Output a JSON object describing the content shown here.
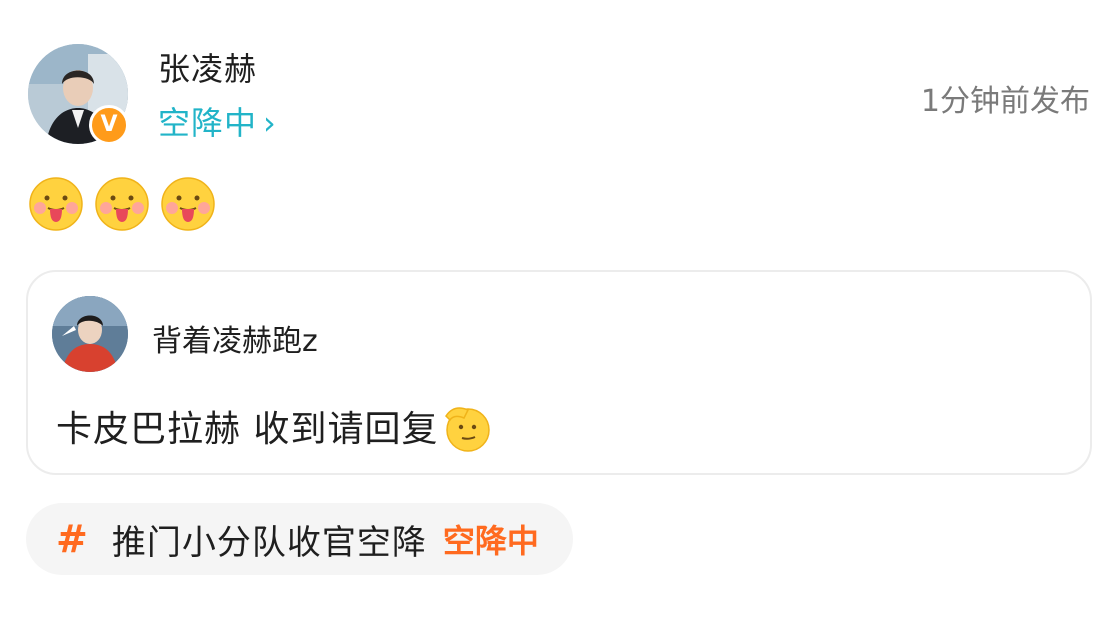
{
  "post": {
    "author": "张凌赫",
    "status_label": "空降中",
    "time": "1分钟前发布",
    "verified_badge": "V",
    "emojis": [
      "tongue-out-emoji",
      "tongue-out-emoji",
      "tongue-out-emoji"
    ]
  },
  "quote": {
    "user": "背着凌赫跑z",
    "text": "卡皮巴拉赫 收到请回复",
    "emoji": "salute-emoji"
  },
  "topic": {
    "hash": "#",
    "title": "推门小分队收官空降",
    "status": "空降中"
  },
  "colors": {
    "accent_cyan": "#22b4c8",
    "accent_orange": "#ff6a1f",
    "badge_orange": "#ff9b1a",
    "text_primary": "#1f1f1f",
    "text_secondary": "#7a7a7a",
    "card_border": "#ececec",
    "pill_bg": "#f5f5f5"
  }
}
